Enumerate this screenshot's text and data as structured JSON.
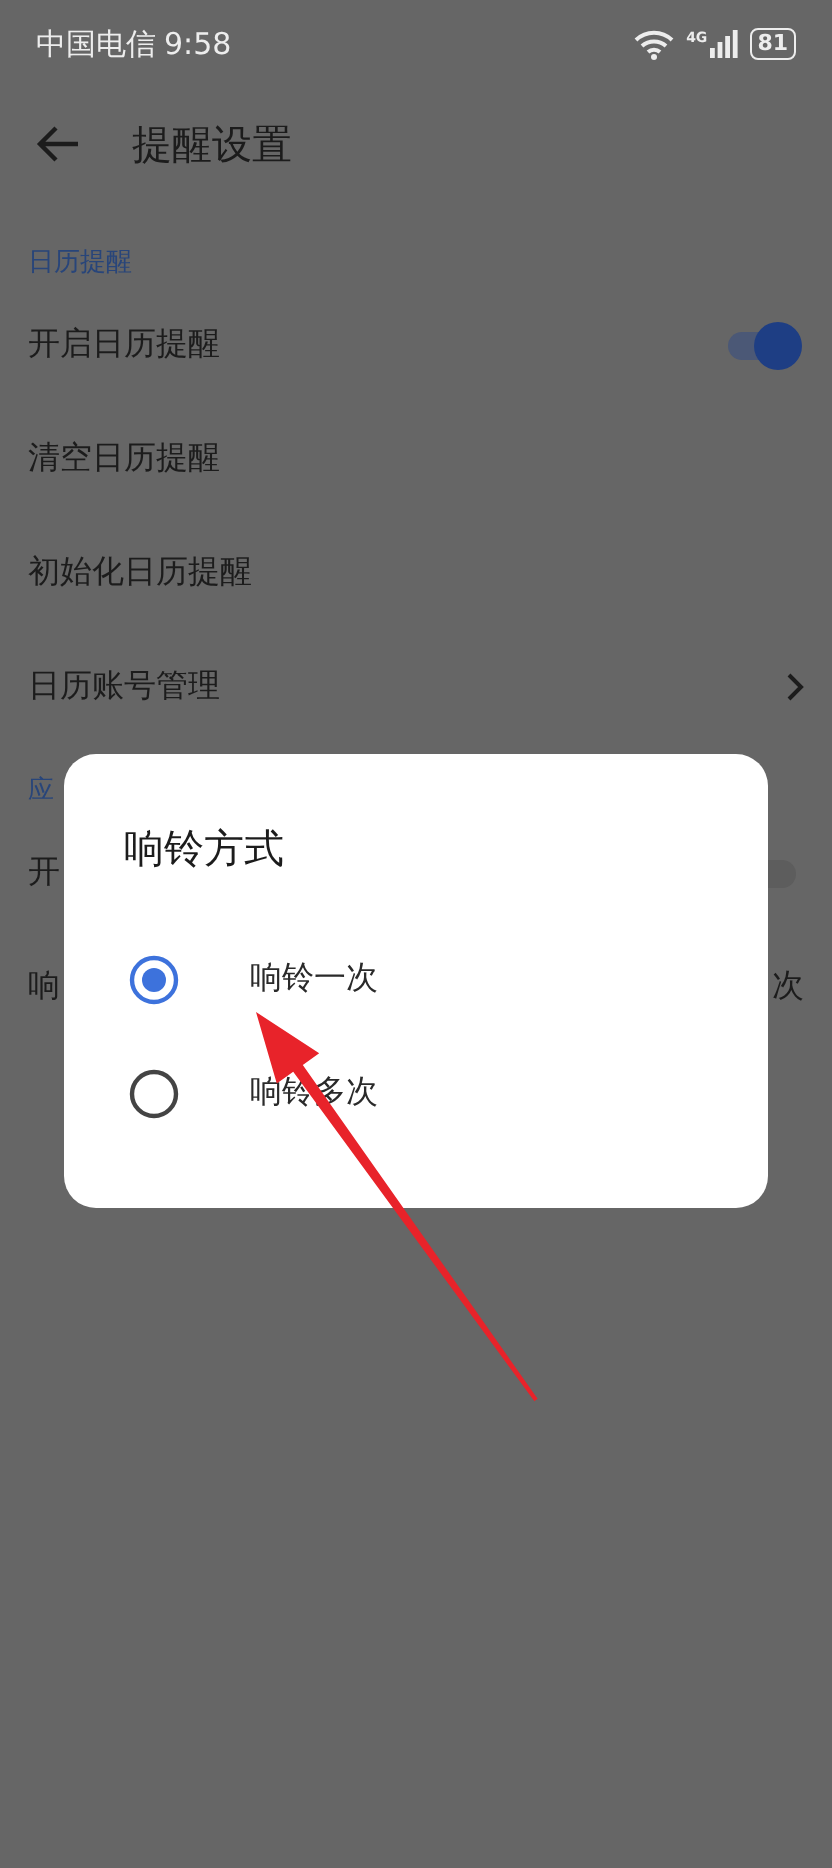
{
  "status_bar": {
    "carrier": "中国电信",
    "time": "9:58",
    "network": "4G",
    "battery": "81"
  },
  "header": {
    "title": "提醒设置"
  },
  "sections": [
    {
      "title": "日历提醒",
      "items": [
        {
          "kind": "switch",
          "label": "开启日历提醒",
          "on": true
        },
        {
          "kind": "plain",
          "label": "清空日历提醒"
        },
        {
          "kind": "plain",
          "label": "初始化日历提醒"
        },
        {
          "kind": "link",
          "label": "日历账号管理"
        }
      ]
    },
    {
      "title": "应",
      "items": [
        {
          "kind": "switch",
          "label": "开",
          "on": false
        },
        {
          "kind": "value",
          "label": "响",
          "value": "次"
        }
      ]
    }
  ],
  "dialog": {
    "title": "响铃方式",
    "options": [
      {
        "label": "响铃一次",
        "selected": true
      },
      {
        "label": "响铃多次",
        "selected": false
      }
    ]
  },
  "annotations": [
    {
      "kind": "arrow"
    }
  ]
}
